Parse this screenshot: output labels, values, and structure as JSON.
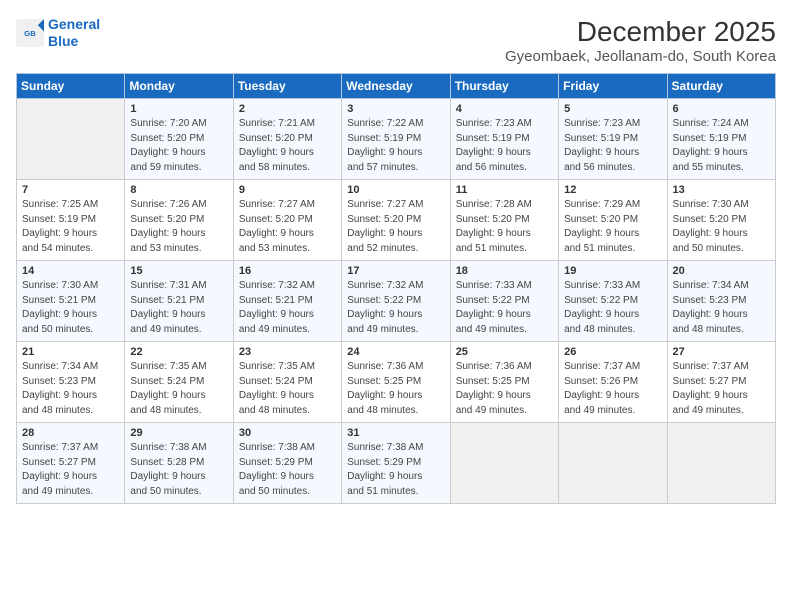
{
  "header": {
    "logo_line1": "General",
    "logo_line2": "Blue",
    "title": "December 2025",
    "subtitle": "Gyeombaek, Jeollanam-do, South Korea"
  },
  "days_of_week": [
    "Sunday",
    "Monday",
    "Tuesday",
    "Wednesday",
    "Thursday",
    "Friday",
    "Saturday"
  ],
  "weeks": [
    [
      {
        "day": "",
        "content": ""
      },
      {
        "day": "1",
        "content": "Sunrise: 7:20 AM\nSunset: 5:20 PM\nDaylight: 9 hours\nand 59 minutes."
      },
      {
        "day": "2",
        "content": "Sunrise: 7:21 AM\nSunset: 5:20 PM\nDaylight: 9 hours\nand 58 minutes."
      },
      {
        "day": "3",
        "content": "Sunrise: 7:22 AM\nSunset: 5:19 PM\nDaylight: 9 hours\nand 57 minutes."
      },
      {
        "day": "4",
        "content": "Sunrise: 7:23 AM\nSunset: 5:19 PM\nDaylight: 9 hours\nand 56 minutes."
      },
      {
        "day": "5",
        "content": "Sunrise: 7:23 AM\nSunset: 5:19 PM\nDaylight: 9 hours\nand 56 minutes."
      },
      {
        "day": "6",
        "content": "Sunrise: 7:24 AM\nSunset: 5:19 PM\nDaylight: 9 hours\nand 55 minutes."
      }
    ],
    [
      {
        "day": "7",
        "content": "Sunrise: 7:25 AM\nSunset: 5:19 PM\nDaylight: 9 hours\nand 54 minutes."
      },
      {
        "day": "8",
        "content": "Sunrise: 7:26 AM\nSunset: 5:20 PM\nDaylight: 9 hours\nand 53 minutes."
      },
      {
        "day": "9",
        "content": "Sunrise: 7:27 AM\nSunset: 5:20 PM\nDaylight: 9 hours\nand 53 minutes."
      },
      {
        "day": "10",
        "content": "Sunrise: 7:27 AM\nSunset: 5:20 PM\nDaylight: 9 hours\nand 52 minutes."
      },
      {
        "day": "11",
        "content": "Sunrise: 7:28 AM\nSunset: 5:20 PM\nDaylight: 9 hours\nand 51 minutes."
      },
      {
        "day": "12",
        "content": "Sunrise: 7:29 AM\nSunset: 5:20 PM\nDaylight: 9 hours\nand 51 minutes."
      },
      {
        "day": "13",
        "content": "Sunrise: 7:30 AM\nSunset: 5:20 PM\nDaylight: 9 hours\nand 50 minutes."
      }
    ],
    [
      {
        "day": "14",
        "content": "Sunrise: 7:30 AM\nSunset: 5:21 PM\nDaylight: 9 hours\nand 50 minutes."
      },
      {
        "day": "15",
        "content": "Sunrise: 7:31 AM\nSunset: 5:21 PM\nDaylight: 9 hours\nand 49 minutes."
      },
      {
        "day": "16",
        "content": "Sunrise: 7:32 AM\nSunset: 5:21 PM\nDaylight: 9 hours\nand 49 minutes."
      },
      {
        "day": "17",
        "content": "Sunrise: 7:32 AM\nSunset: 5:22 PM\nDaylight: 9 hours\nand 49 minutes."
      },
      {
        "day": "18",
        "content": "Sunrise: 7:33 AM\nSunset: 5:22 PM\nDaylight: 9 hours\nand 49 minutes."
      },
      {
        "day": "19",
        "content": "Sunrise: 7:33 AM\nSunset: 5:22 PM\nDaylight: 9 hours\nand 48 minutes."
      },
      {
        "day": "20",
        "content": "Sunrise: 7:34 AM\nSunset: 5:23 PM\nDaylight: 9 hours\nand 48 minutes."
      }
    ],
    [
      {
        "day": "21",
        "content": "Sunrise: 7:34 AM\nSunset: 5:23 PM\nDaylight: 9 hours\nand 48 minutes."
      },
      {
        "day": "22",
        "content": "Sunrise: 7:35 AM\nSunset: 5:24 PM\nDaylight: 9 hours\nand 48 minutes."
      },
      {
        "day": "23",
        "content": "Sunrise: 7:35 AM\nSunset: 5:24 PM\nDaylight: 9 hours\nand 48 minutes."
      },
      {
        "day": "24",
        "content": "Sunrise: 7:36 AM\nSunset: 5:25 PM\nDaylight: 9 hours\nand 48 minutes."
      },
      {
        "day": "25",
        "content": "Sunrise: 7:36 AM\nSunset: 5:25 PM\nDaylight: 9 hours\nand 49 minutes."
      },
      {
        "day": "26",
        "content": "Sunrise: 7:37 AM\nSunset: 5:26 PM\nDaylight: 9 hours\nand 49 minutes."
      },
      {
        "day": "27",
        "content": "Sunrise: 7:37 AM\nSunset: 5:27 PM\nDaylight: 9 hours\nand 49 minutes."
      }
    ],
    [
      {
        "day": "28",
        "content": "Sunrise: 7:37 AM\nSunset: 5:27 PM\nDaylight: 9 hours\nand 49 minutes."
      },
      {
        "day": "29",
        "content": "Sunrise: 7:38 AM\nSunset: 5:28 PM\nDaylight: 9 hours\nand 50 minutes."
      },
      {
        "day": "30",
        "content": "Sunrise: 7:38 AM\nSunset: 5:29 PM\nDaylight: 9 hours\nand 50 minutes."
      },
      {
        "day": "31",
        "content": "Sunrise: 7:38 AM\nSunset: 5:29 PM\nDaylight: 9 hours\nand 51 minutes."
      },
      {
        "day": "",
        "content": ""
      },
      {
        "day": "",
        "content": ""
      },
      {
        "day": "",
        "content": ""
      }
    ]
  ]
}
